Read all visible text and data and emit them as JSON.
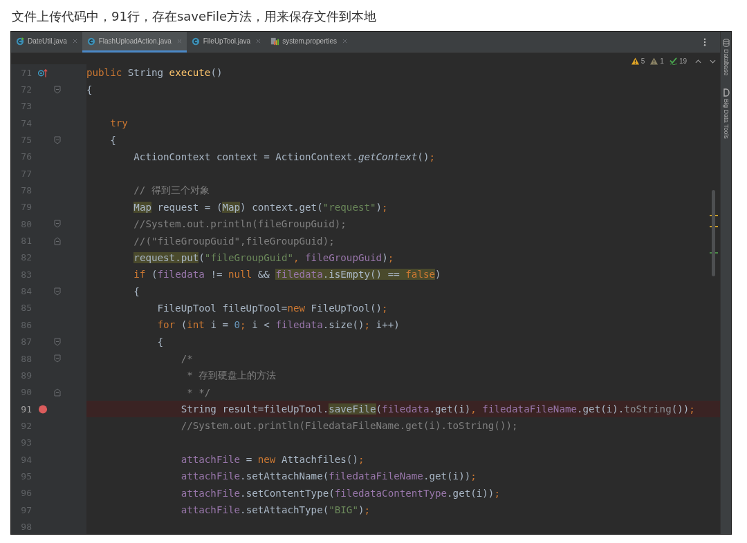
{
  "caption": "文件上传代码中，91行，存在saveFile方法，用来保存文件到本地",
  "tabs": [
    {
      "label": "DateUtil.java",
      "kind": "class-run",
      "selected": false
    },
    {
      "label": "FlashUploadAction.java",
      "kind": "class",
      "selected": true
    },
    {
      "label": "FileUpTool.java",
      "kind": "class",
      "selected": false
    },
    {
      "label": "system.properties",
      "kind": "properties",
      "selected": false
    }
  ],
  "inspections": [
    {
      "kind": "warning",
      "count": "5"
    },
    {
      "kind": "weak-warning",
      "count": "1"
    },
    {
      "kind": "typo",
      "count": "19"
    }
  ],
  "side_tools": [
    {
      "label": "Database",
      "kind": "database"
    },
    {
      "label": "Big Data Tools",
      "kind": "letter"
    }
  ],
  "lines": [
    {
      "number": "71",
      "kind": "override",
      "tokens": [
        {
          "kind": "kw",
          "text": "public "
        },
        {
          "kind": "plain",
          "text": "String "
        },
        {
          "kind": "fn",
          "text": "execute"
        },
        {
          "kind": "plain",
          "text": "()"
        }
      ]
    },
    {
      "number": "72",
      "kind": "fold-start",
      "tokens": [
        {
          "kind": "plain",
          "text": "{"
        }
      ]
    },
    {
      "number": "73"
    },
    {
      "number": "74",
      "tokens": [
        {
          "kind": "kw",
          "text": "    try"
        }
      ]
    },
    {
      "number": "75",
      "kind": "fold-start",
      "tokens": [
        {
          "kind": "plain",
          "text": "    {"
        }
      ]
    },
    {
      "number": "76",
      "tokens": [
        {
          "kind": "plain",
          "text": "        ActionContext context = ActionContext."
        },
        {
          "kind": "italic",
          "text": "getContext"
        },
        {
          "kind": "plain",
          "text": "()"
        },
        {
          "kind": "kw",
          "text": ";"
        }
      ]
    },
    {
      "number": "77"
    },
    {
      "number": "78",
      "tokens": [
        {
          "kind": "comment",
          "text": "        // 得到三个对象"
        }
      ]
    },
    {
      "number": "79",
      "tokens": [
        {
          "kind": "plain",
          "text": "        Map",
          "hl": true
        },
        {
          "kind": "plain",
          "text": " request = ("
        },
        {
          "kind": "plain",
          "text": "Map",
          "hl": true
        },
        {
          "kind": "plain",
          "text": ") context.get("
        },
        {
          "kind": "str",
          "text": "\"request\""
        },
        {
          "kind": "plain",
          "text": ")"
        },
        {
          "kind": "kw",
          "text": ";"
        }
      ]
    },
    {
      "number": "80",
      "kind": "fold-start",
      "tokens": [
        {
          "kind": "comment",
          "text": "        //System.out.println(fileGroupGuid);"
        }
      ]
    },
    {
      "number": "81",
      "kind": "fold-end",
      "tokens": [
        {
          "kind": "comment",
          "text": "        //(\"fileGroupGuid\",fileGroupGuid);"
        }
      ]
    },
    {
      "number": "82",
      "tokens": [
        {
          "kind": "plain",
          "text": "        request.put",
          "hl": true
        },
        {
          "kind": "plain",
          "text": "("
        },
        {
          "kind": "str",
          "text": "\"fileGroupGuid\""
        },
        {
          "kind": "kw",
          "text": ", "
        },
        {
          "kind": "field",
          "text": "fileGroupGuid"
        },
        {
          "kind": "plain",
          "text": ")"
        },
        {
          "kind": "kw",
          "text": ";"
        }
      ]
    },
    {
      "number": "83",
      "tokens": [
        {
          "kind": "kw",
          "text": "        if "
        },
        {
          "kind": "plain",
          "text": "("
        },
        {
          "kind": "field",
          "text": "filedata"
        },
        {
          "kind": "plain",
          "text": " != "
        },
        {
          "kind": "kw",
          "text": "null"
        },
        {
          "kind": "plain",
          "text": " && "
        },
        {
          "kind": "field",
          "text": "filedata",
          "hl": true
        },
        {
          "kind": "plain",
          "text": ".isEmpty() == ",
          "hl": true
        },
        {
          "kind": "kw",
          "text": "false",
          "hl": true
        },
        {
          "kind": "plain",
          "text": ")"
        }
      ]
    },
    {
      "number": "84",
      "kind": "fold-start",
      "tokens": [
        {
          "kind": "plain",
          "text": "        {"
        }
      ]
    },
    {
      "number": "85",
      "tokens": [
        {
          "kind": "plain",
          "text": "            FileUpTool fileUpTool="
        },
        {
          "kind": "kw",
          "text": "new "
        },
        {
          "kind": "plain",
          "text": "FileUpTool()"
        },
        {
          "kind": "kw",
          "text": ";"
        }
      ]
    },
    {
      "number": "86",
      "tokens": [
        {
          "kind": "kw",
          "text": "            for "
        },
        {
          "kind": "plain",
          "text": "("
        },
        {
          "kind": "kw",
          "text": "int "
        },
        {
          "kind": "plain",
          "text": "i = "
        },
        {
          "kind": "num",
          "text": "0"
        },
        {
          "kind": "kw",
          "text": "; "
        },
        {
          "kind": "plain",
          "text": "i < "
        },
        {
          "kind": "field",
          "text": "filedata"
        },
        {
          "kind": "plain",
          "text": ".size()"
        },
        {
          "kind": "kw",
          "text": "; "
        },
        {
          "kind": "plain",
          "text": "i++)"
        }
      ]
    },
    {
      "number": "87",
      "kind": "fold-start",
      "tokens": [
        {
          "kind": "plain",
          "text": "            {"
        }
      ]
    },
    {
      "number": "88",
      "kind": "fold-start",
      "tokens": [
        {
          "kind": "comment",
          "text": "                /*"
        }
      ]
    },
    {
      "number": "89",
      "tokens": [
        {
          "kind": "comment",
          "text": "                 * 存到硬盘上的方法"
        }
      ]
    },
    {
      "number": "90",
      "kind": "fold-end",
      "tokens": [
        {
          "kind": "comment",
          "text": "                 * */"
        }
      ]
    },
    {
      "number": "91",
      "kind": "breakpoint",
      "tokens": [
        {
          "kind": "plain",
          "text": "                String result=fileUpTool."
        },
        {
          "kind": "plain",
          "text": "saveFile",
          "hl": true
        },
        {
          "kind": "plain",
          "text": "("
        },
        {
          "kind": "field",
          "text": "filedata"
        },
        {
          "kind": "plain",
          "text": ".get(i)"
        },
        {
          "kind": "kw",
          "text": ", "
        },
        {
          "kind": "field",
          "text": "filedataFileName"
        },
        {
          "kind": "plain",
          "text": ".get(i)."
        },
        {
          "kind": "dim",
          "text": "toString"
        },
        {
          "kind": "plain",
          "text": "())"
        },
        {
          "kind": "kw",
          "text": ";"
        }
      ]
    },
    {
      "number": "92",
      "tokens": [
        {
          "kind": "comment",
          "text": "                //System.out.println(FiledataFileName.get(i).toString());"
        }
      ]
    },
    {
      "number": "93"
    },
    {
      "number": "94",
      "tokens": [
        {
          "kind": "field",
          "text": "                attachFile"
        },
        {
          "kind": "plain",
          "text": " = "
        },
        {
          "kind": "kw",
          "text": "new "
        },
        {
          "kind": "plain",
          "text": "Attachfiles()"
        },
        {
          "kind": "kw",
          "text": ";"
        }
      ]
    },
    {
      "number": "95",
      "tokens": [
        {
          "kind": "field",
          "text": "                attachFile"
        },
        {
          "kind": "plain",
          "text": ".setAttachName("
        },
        {
          "kind": "field",
          "text": "filedataFileName"
        },
        {
          "kind": "plain",
          "text": ".get(i))"
        },
        {
          "kind": "kw",
          "text": ";"
        }
      ]
    },
    {
      "number": "96",
      "tokens": [
        {
          "kind": "field",
          "text": "                attachFile"
        },
        {
          "kind": "plain",
          "text": ".setContentType("
        },
        {
          "kind": "field",
          "text": "filedataContentType"
        },
        {
          "kind": "plain",
          "text": ".get(i))"
        },
        {
          "kind": "kw",
          "text": ";"
        }
      ]
    },
    {
      "number": "97",
      "tokens": [
        {
          "kind": "field",
          "text": "                attachFile"
        },
        {
          "kind": "plain",
          "text": ".setAttachType("
        },
        {
          "kind": "str",
          "text": "\"BIG\""
        },
        {
          "kind": "plain",
          "text": ")"
        },
        {
          "kind": "kw",
          "text": ";"
        }
      ]
    },
    {
      "number": "98"
    }
  ]
}
